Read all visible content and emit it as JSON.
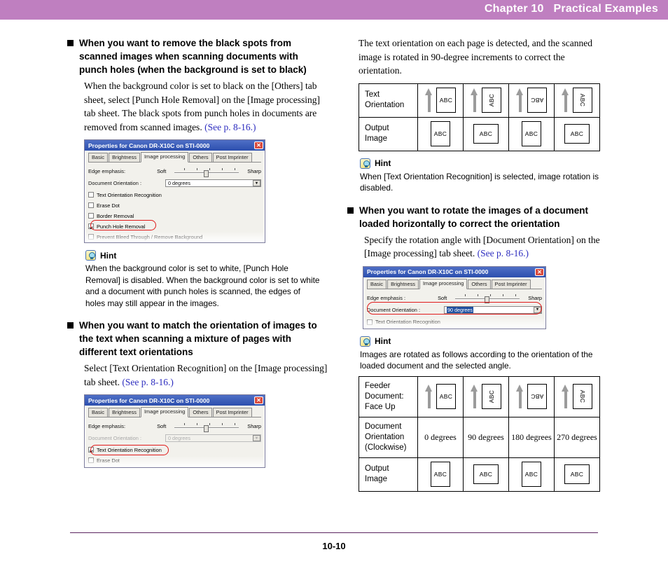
{
  "header": {
    "title": "Chapter 10   Practical Examples"
  },
  "footer": {
    "page_number": "10-10"
  },
  "left_column": {
    "section1": {
      "heading": "When you want to remove the black spots from scanned images when scanning documents with punch holes (when the background is set to black)",
      "body": "When the background color is set to black on the [Others] tab sheet, select [Punch Hole Removal] on the [Image processing] tab sheet. The black spots from punch holes in documents are removed from scanned images. ",
      "ref": "(See p. 8-16.)"
    },
    "dialog1": {
      "title": "Properties for Canon DR-X10C on STI-0000",
      "close_label": "✕",
      "tabs": [
        "Basic",
        "Brightness",
        "Image processing",
        "Others",
        "Post Imprinter"
      ],
      "selected_tab": "Image processing",
      "edge_emphasis_label": "Edge emphasis:",
      "soft_label": "Soft",
      "sharp_label": "Sharp",
      "document_orientation_label": "Document Orientation :",
      "document_orientation_value": "0 degrees",
      "checkboxes": [
        {
          "label": "Text Orientation Recognition",
          "checked": false,
          "dimmed": false
        },
        {
          "label": "Erase Dot",
          "checked": false,
          "dimmed": false
        },
        {
          "label": "Border Removal",
          "checked": false,
          "dimmed": false
        },
        {
          "label": "Punch Hole Removal",
          "checked": true,
          "dimmed": false
        },
        {
          "label": "Prevent Bleed Through / Remove Background",
          "checked": false,
          "dimmed": false
        }
      ],
      "highlighted_item": "Punch Hole Removal"
    },
    "hint1": {
      "label": "Hint",
      "body": "When the background color is set to white, [Punch Hole Removal] is disabled. When the background color is set to white and a document with punch holes is scanned, the edges of holes may still appear in the images."
    },
    "section2": {
      "heading": "When you want to match the orientation of images to the text when scanning a mixture of pages with different text orientations",
      "body": "Select [Text Orientation Recognition] on the [Image processing] tab sheet. ",
      "ref": "(See p. 8-16.)"
    },
    "dialog2": {
      "title": "Properties for Canon DR-X10C on STI-0000",
      "close_label": "✕",
      "tabs": [
        "Basic",
        "Brightness",
        "Image processing",
        "Others",
        "Post Imprinter"
      ],
      "selected_tab": "Image processing",
      "edge_emphasis_label": "Edge emphasis:",
      "soft_label": "Soft",
      "sharp_label": "Sharp",
      "document_orientation_label": "Document Orientation :",
      "document_orientation_value": "0 degrees",
      "document_orientation_dimmed": true,
      "checkboxes": [
        {
          "label": "Text Orientation Recognition",
          "checked": true,
          "dimmed": false
        },
        {
          "label": "Erase Dot",
          "checked": false,
          "dimmed": false
        }
      ],
      "highlighted_item": "Text Orientation Recognition"
    }
  },
  "right_column": {
    "intro": "The text orientation on each page is detected, and the scanned image is rotated in 90-degree increments to correct the orientation.",
    "table1": {
      "rows": [
        {
          "header": "Text\nOrientation",
          "cells": [
            {
              "arrow": true,
              "page": "portrait",
              "text": "ABC",
              "rotation": "r0"
            },
            {
              "arrow": true,
              "page": "portrait",
              "text": "ABC",
              "rotation": "r90"
            },
            {
              "arrow": true,
              "page": "portrait",
              "text": "ABC",
              "rotation": "r180"
            },
            {
              "arrow": true,
              "page": "portrait",
              "text": "ABC",
              "rotation": "r270"
            }
          ]
        },
        {
          "header": "Output\nImage",
          "cells": [
            {
              "arrow": false,
              "page": "portrait",
              "text": "ABC",
              "rotation": "r0"
            },
            {
              "arrow": false,
              "page": "landscape",
              "text": "ABC",
              "rotation": "r0"
            },
            {
              "arrow": false,
              "page": "portrait",
              "text": "ABC",
              "rotation": "r0"
            },
            {
              "arrow": false,
              "page": "landscape",
              "text": "ABC",
              "rotation": "r0"
            }
          ]
        }
      ]
    },
    "hint1": {
      "label": "Hint",
      "body": "When [Text Orientation Recognition] is selected, image rotation is disabled."
    },
    "section1": {
      "heading": "When you want to rotate the images of a document loaded horizontally to correct the orientation",
      "body": "Specify the rotation angle with [Document Orientation] on the [Image processing] tab sheet. ",
      "ref": "(See p. 8-16.)"
    },
    "dialog3": {
      "title": "Properties for Canon DR-X10C on STI-0000",
      "close_label": "✕",
      "tabs": [
        "Basic",
        "Brightness",
        "Image processing",
        "Others",
        "Post Imprinter"
      ],
      "selected_tab": "Image processing",
      "edge_emphasis_label": "Edge emphasis :",
      "soft_label": "Soft",
      "sharp_label": "Sharp",
      "document_orientation_label": "Document Orientation :",
      "document_orientation_value": "90 degrees",
      "checkboxes": [
        {
          "label": "Text Orientation Recognition",
          "checked": false,
          "dimmed": false
        }
      ],
      "highlighted_item": "Document Orientation"
    },
    "hint2": {
      "label": "Hint",
      "body": "Images are rotated as follows according to the orientation of the loaded document and the selected angle."
    },
    "table2": {
      "rows": [
        {
          "header": "Feeder\nDocument:\nFace Up",
          "cells": [
            {
              "arrow": true,
              "page": "portrait",
              "text": "ABC",
              "rotation": "r0"
            },
            {
              "arrow": true,
              "page": "portrait",
              "text": "ABC",
              "rotation": "r90"
            },
            {
              "arrow": true,
              "page": "portrait",
              "text": "ABC",
              "rotation": "r180"
            },
            {
              "arrow": true,
              "page": "portrait",
              "text": "ABC",
              "rotation": "r270"
            }
          ]
        },
        {
          "header": "Document\nOrientation\n(Clockwise)",
          "degrees": [
            "0 degrees",
            "90 degrees",
            "180 degrees",
            "270 degrees"
          ]
        },
        {
          "header": "Output\nImage",
          "cells": [
            {
              "arrow": false,
              "page": "portrait",
              "text": "ABC",
              "rotation": "r0"
            },
            {
              "arrow": false,
              "page": "landscape",
              "text": "ABC",
              "rotation": "r0"
            },
            {
              "arrow": false,
              "page": "portrait",
              "text": "ABC",
              "rotation": "r0"
            },
            {
              "arrow": false,
              "page": "landscape",
              "text": "ABC",
              "rotation": "r0"
            }
          ]
        }
      ]
    }
  },
  "colors": {
    "header_bar": "#bf7fc0",
    "link": "#2d2dbf",
    "highlight_oval": "#e01b1b",
    "footer_rule": "#5b2560"
  }
}
